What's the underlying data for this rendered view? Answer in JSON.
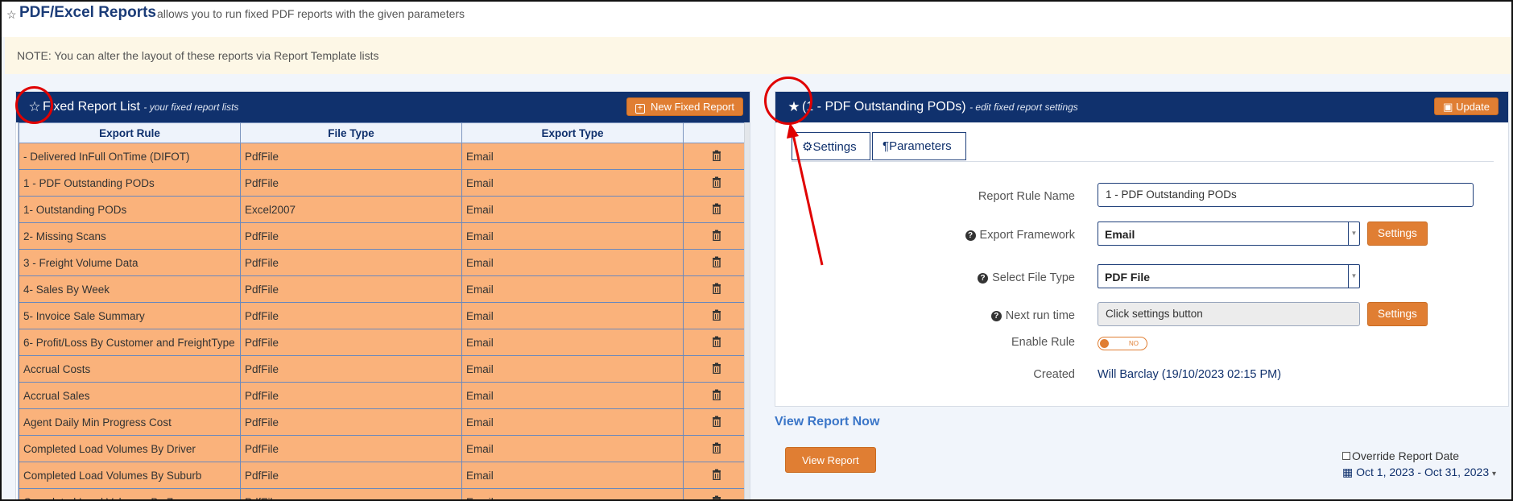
{
  "header": {
    "star": "☆",
    "title": "PDF/Excel Reports",
    "subtitle": "allows you to run fixed PDF reports with the given parameters"
  },
  "note": "NOTE: You can alter the layout of these reports via Report Template lists",
  "left_panel": {
    "title": "Fixed Report List",
    "subtitle": "- your fixed report lists",
    "new_button": "New Fixed Report",
    "columns": [
      "Export Rule",
      "File Type",
      "Export Type",
      ""
    ],
    "rows": [
      {
        "rule": "- Delivered InFull OnTime (DIFOT)",
        "file_type": "PdfFile",
        "export_type": "Email"
      },
      {
        "rule": "1 - PDF Outstanding PODs",
        "file_type": "PdfFile",
        "export_type": "Email"
      },
      {
        "rule": "1- Outstanding PODs",
        "file_type": "Excel2007",
        "export_type": "Email"
      },
      {
        "rule": "2- Missing Scans",
        "file_type": "PdfFile",
        "export_type": "Email"
      },
      {
        "rule": "3 - Freight Volume Data",
        "file_type": "PdfFile",
        "export_type": "Email"
      },
      {
        "rule": "4- Sales By Week",
        "file_type": "PdfFile",
        "export_type": "Email"
      },
      {
        "rule": "5- Invoice Sale Summary",
        "file_type": "PdfFile",
        "export_type": "Email"
      },
      {
        "rule": "6- Profit/Loss By Customer and FreightType",
        "file_type": "PdfFile",
        "export_type": "Email"
      },
      {
        "rule": "Accrual Costs",
        "file_type": "PdfFile",
        "export_type": "Email"
      },
      {
        "rule": "Accrual Sales",
        "file_type": "PdfFile",
        "export_type": "Email"
      },
      {
        "rule": "Agent Daily Min Progress Cost",
        "file_type": "PdfFile",
        "export_type": "Email"
      },
      {
        "rule": "Completed Load Volumes By Driver",
        "file_type": "PdfFile",
        "export_type": "Email"
      },
      {
        "rule": "Completed Load Volumes By Suburb",
        "file_type": "PdfFile",
        "export_type": "Email"
      },
      {
        "rule": "Completed Load Volumes By Zone",
        "file_type": "PdfFile",
        "export_type": "Email"
      }
    ]
  },
  "right_panel": {
    "title": "(1 - PDF Outstanding PODs)",
    "subtitle": "- edit fixed report settings",
    "update_button": "Update",
    "tabs": [
      "Settings",
      "Parameters"
    ],
    "form": {
      "report_rule_name_label": "Report Rule Name",
      "report_rule_name_value": "1 - PDF Outstanding PODs",
      "export_framework_label": "Export Framework",
      "export_framework_value": "Email",
      "settings_button": "Settings",
      "file_type_label": "Select File Type",
      "file_type_value": "PDF File",
      "next_run_label": "Next run time",
      "next_run_value": "Click settings button",
      "enable_rule_label": "Enable Rule",
      "enable_rule_state": "NO",
      "created_label": "Created",
      "created_value": "Will Barclay (19/10/2023 02:15 PM)"
    }
  },
  "view_report": {
    "heading": "View Report Now",
    "button": "View Report",
    "override_label": "Override Report Date",
    "date_range": "Oct 1, 2023 - Oct 31, 2023",
    "date_caret": "▾"
  },
  "colors": {
    "panel_header": "#10316d",
    "accent_orange": "#e07e33",
    "row_fill": "#fab27b",
    "annotation_red": "#e00000"
  }
}
